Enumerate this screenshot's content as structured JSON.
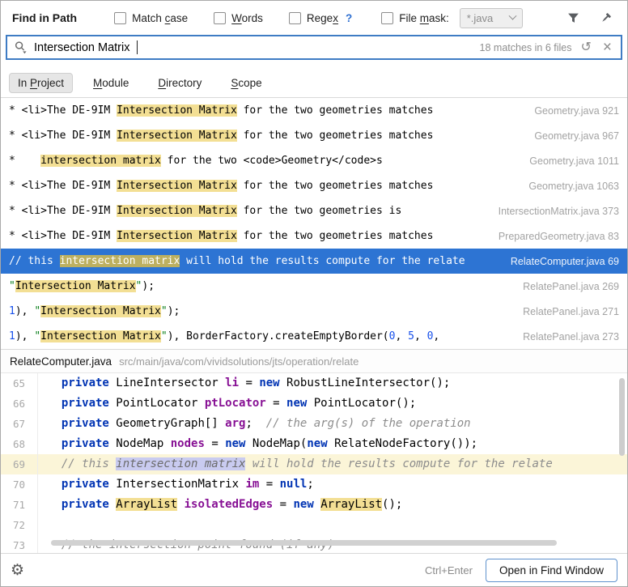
{
  "colors": {
    "accent": "#3f7cc4",
    "selection": "#2d74d3",
    "match": "#f3df94",
    "match-olive": "#bdb060",
    "line-hl": "#fbf5d8",
    "found-sel": "#c9cbf0",
    "kw": "#0033b3",
    "field": "#871094",
    "comment": "#8c8c8c",
    "num": "#1750eb",
    "str": "#067d17"
  },
  "titlebar": {
    "title": "Find in Path",
    "options": [
      {
        "label": "Match case",
        "mnemonic_index": 6,
        "checked": false
      },
      {
        "label": "Words",
        "mnemonic_index": 0,
        "checked": false
      },
      {
        "label": "Regex",
        "mnemonic_index": 4,
        "checked": false,
        "help": "?"
      }
    ],
    "file_mask": {
      "label": "File mask:",
      "mnemonic_index": 5,
      "checked": false,
      "value": "*.java"
    }
  },
  "search": {
    "query": "Intersection Matrix",
    "summary": "18 matches in 6 files"
  },
  "scope_tabs": [
    {
      "label": "In Project",
      "mnemonic_index": 3,
      "selected": true
    },
    {
      "label": "Module",
      "mnemonic_index": 0,
      "selected": false
    },
    {
      "label": "Directory",
      "mnemonic_index": 0,
      "selected": false
    },
    {
      "label": "Scope",
      "mnemonic_index": 0,
      "selected": false
    }
  ],
  "results": [
    {
      "selected": false,
      "file": "Geometry.java",
      "line": "921",
      "segments": [
        {
          "t": "* <li>The DE-9IM "
        },
        {
          "t": "Intersection Matrix",
          "h": true
        },
        {
          "t": " for the two geometries matches"
        }
      ]
    },
    {
      "selected": false,
      "file": "Geometry.java",
      "line": "967",
      "segments": [
        {
          "t": "* <li>The DE-9IM "
        },
        {
          "t": "Intersection Matrix",
          "h": true
        },
        {
          "t": " for the two geometries matches"
        }
      ]
    },
    {
      "selected": false,
      "file": "Geometry.java",
      "line": "1011",
      "segments": [
        {
          "t": "*    "
        },
        {
          "t": "intersection matrix",
          "h": true
        },
        {
          "t": " for the two <code>Geometry</code>s"
        }
      ]
    },
    {
      "selected": false,
      "file": "Geometry.java",
      "line": "1063",
      "segments": [
        {
          "t": "* <li>The DE-9IM "
        },
        {
          "t": "Intersection Matrix",
          "h": true
        },
        {
          "t": " for the two geometries matches"
        }
      ]
    },
    {
      "selected": false,
      "file": "IntersectionMatrix.java",
      "line": "373",
      "segments": [
        {
          "t": "* <li>The DE-9IM "
        },
        {
          "t": "Intersection Matrix",
          "h": true
        },
        {
          "t": " for the two geometries is"
        }
      ]
    },
    {
      "selected": false,
      "file": "PreparedGeometry.java",
      "line": "83",
      "segments": [
        {
          "t": "* <li>The DE-9IM "
        },
        {
          "t": "Intersection Matrix",
          "h": true
        },
        {
          "t": " for the two geometries matches"
        }
      ]
    },
    {
      "selected": true,
      "file": "RelateComputer.java",
      "line": "69",
      "segments": [
        {
          "t": "// this "
        },
        {
          "t": "intersection matrix",
          "h": true
        },
        {
          "t": " will hold the results compute for the relate"
        }
      ]
    },
    {
      "selected": false,
      "file": "RelatePanel.java",
      "line": "269",
      "segments": [
        {
          "t": "\"",
          "c": "str"
        },
        {
          "t": "Intersection Matrix",
          "h": true
        },
        {
          "t": "\"",
          "c": "str"
        },
        {
          "t": ");"
        }
      ]
    },
    {
      "selected": false,
      "file": "RelatePanel.java",
      "line": "271",
      "segments": [
        {
          "t": "1",
          "c": "num"
        },
        {
          "t": "), "
        },
        {
          "t": "\"",
          "c": "str"
        },
        {
          "t": "Intersection Matrix",
          "h": true
        },
        {
          "t": "\"",
          "c": "str"
        },
        {
          "t": ");"
        }
      ]
    },
    {
      "selected": false,
      "file": "RelatePanel.java",
      "line": "273",
      "segments": [
        {
          "t": "1",
          "c": "num"
        },
        {
          "t": "), "
        },
        {
          "t": "\"",
          "c": "str"
        },
        {
          "t": "Intersection Matrix",
          "h": true
        },
        {
          "t": "\"",
          "c": "str"
        },
        {
          "t": "), BorderFactory.createEmptyBorder("
        },
        {
          "t": "0",
          "c": "num"
        },
        {
          "t": ", "
        },
        {
          "t": "5",
          "c": "num"
        },
        {
          "t": ", "
        },
        {
          "t": "0",
          "c": "num"
        },
        {
          "t": ","
        }
      ]
    }
  ],
  "preview": {
    "file": "RelateComputer.java",
    "path": "src/main/java/com/vividsolutions/jts/operation/relate",
    "lines": [
      {
        "num": "65",
        "current": false,
        "tokens": [
          {
            "t": "  "
          },
          {
            "t": "private ",
            "c": "k"
          },
          {
            "t": "LineIntersector "
          },
          {
            "t": "li",
            "c": "f"
          },
          {
            "t": " = "
          },
          {
            "t": "new ",
            "c": "k"
          },
          {
            "t": "RobustLineIntersector();"
          }
        ]
      },
      {
        "num": "66",
        "current": false,
        "tokens": [
          {
            "t": "  "
          },
          {
            "t": "private ",
            "c": "k"
          },
          {
            "t": "PointLocator "
          },
          {
            "t": "ptLocator",
            "c": "f"
          },
          {
            "t": " = "
          },
          {
            "t": "new ",
            "c": "k"
          },
          {
            "t": "PointLocator();"
          }
        ]
      },
      {
        "num": "67",
        "current": false,
        "tokens": [
          {
            "t": "  "
          },
          {
            "t": "private ",
            "c": "k"
          },
          {
            "t": "GeometryGraph[] "
          },
          {
            "t": "arg",
            "c": "f"
          },
          {
            "t": ";  "
          },
          {
            "t": "// the arg(s) of the operation",
            "c": "c"
          }
        ]
      },
      {
        "num": "68",
        "current": false,
        "tokens": [
          {
            "t": "  "
          },
          {
            "t": "private ",
            "c": "k"
          },
          {
            "t": "NodeMap "
          },
          {
            "t": "nodes",
            "c": "f"
          },
          {
            "t": " = "
          },
          {
            "t": "new ",
            "c": "k"
          },
          {
            "t": "NodeMap("
          },
          {
            "t": "new ",
            "c": "k"
          },
          {
            "t": "RelateNodeFactory());"
          }
        ]
      },
      {
        "num": "69",
        "current": true,
        "tokens": [
          {
            "t": "  // this ",
            "c": "c"
          },
          {
            "t": "intersection matrix",
            "c": "csel"
          },
          {
            "t": " will hold the results compute for the relate",
            "c": "c"
          }
        ]
      },
      {
        "num": "70",
        "current": false,
        "tokens": [
          {
            "t": "  "
          },
          {
            "t": "private ",
            "c": "k"
          },
          {
            "t": "IntersectionMatrix "
          },
          {
            "t": "im",
            "c": "f"
          },
          {
            "t": " = "
          },
          {
            "t": "null",
            "c": "k"
          },
          {
            "t": ";"
          }
        ]
      },
      {
        "num": "71",
        "current": false,
        "tokens": [
          {
            "t": "  "
          },
          {
            "t": "private ",
            "c": "k"
          },
          {
            "t": "ArrayList",
            "c": "y"
          },
          {
            "t": " "
          },
          {
            "t": "isolatedEdges",
            "c": "f"
          },
          {
            "t": " = "
          },
          {
            "t": "new ",
            "c": "k"
          },
          {
            "t": "ArrayList",
            "c": "y"
          },
          {
            "t": "();"
          }
        ]
      },
      {
        "num": "72",
        "current": false,
        "tokens": []
      },
      {
        "num": "73",
        "current": false,
        "tokens": [
          {
            "t": "  // the intersection point found (if any)",
            "c": "c"
          }
        ]
      }
    ]
  },
  "footer": {
    "shortcut": "Ctrl+Enter",
    "button": "Open in Find Window"
  }
}
